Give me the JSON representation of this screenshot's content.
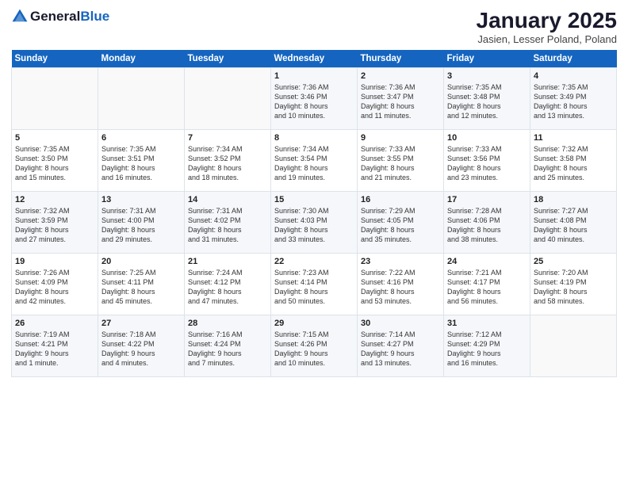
{
  "header": {
    "logo_general": "General",
    "logo_blue": "Blue",
    "title": "January 2025",
    "subtitle": "Jasien, Lesser Poland, Poland"
  },
  "days_of_week": [
    "Sunday",
    "Monday",
    "Tuesday",
    "Wednesday",
    "Thursday",
    "Friday",
    "Saturday"
  ],
  "weeks": [
    [
      {
        "day": "",
        "info": ""
      },
      {
        "day": "",
        "info": ""
      },
      {
        "day": "",
        "info": ""
      },
      {
        "day": "1",
        "info": "Sunrise: 7:36 AM\nSunset: 3:46 PM\nDaylight: 8 hours\nand 10 minutes."
      },
      {
        "day": "2",
        "info": "Sunrise: 7:36 AM\nSunset: 3:47 PM\nDaylight: 8 hours\nand 11 minutes."
      },
      {
        "day": "3",
        "info": "Sunrise: 7:35 AM\nSunset: 3:48 PM\nDaylight: 8 hours\nand 12 minutes."
      },
      {
        "day": "4",
        "info": "Sunrise: 7:35 AM\nSunset: 3:49 PM\nDaylight: 8 hours\nand 13 minutes."
      }
    ],
    [
      {
        "day": "5",
        "info": "Sunrise: 7:35 AM\nSunset: 3:50 PM\nDaylight: 8 hours\nand 15 minutes."
      },
      {
        "day": "6",
        "info": "Sunrise: 7:35 AM\nSunset: 3:51 PM\nDaylight: 8 hours\nand 16 minutes."
      },
      {
        "day": "7",
        "info": "Sunrise: 7:34 AM\nSunset: 3:52 PM\nDaylight: 8 hours\nand 18 minutes."
      },
      {
        "day": "8",
        "info": "Sunrise: 7:34 AM\nSunset: 3:54 PM\nDaylight: 8 hours\nand 19 minutes."
      },
      {
        "day": "9",
        "info": "Sunrise: 7:33 AM\nSunset: 3:55 PM\nDaylight: 8 hours\nand 21 minutes."
      },
      {
        "day": "10",
        "info": "Sunrise: 7:33 AM\nSunset: 3:56 PM\nDaylight: 8 hours\nand 23 minutes."
      },
      {
        "day": "11",
        "info": "Sunrise: 7:32 AM\nSunset: 3:58 PM\nDaylight: 8 hours\nand 25 minutes."
      }
    ],
    [
      {
        "day": "12",
        "info": "Sunrise: 7:32 AM\nSunset: 3:59 PM\nDaylight: 8 hours\nand 27 minutes."
      },
      {
        "day": "13",
        "info": "Sunrise: 7:31 AM\nSunset: 4:00 PM\nDaylight: 8 hours\nand 29 minutes."
      },
      {
        "day": "14",
        "info": "Sunrise: 7:31 AM\nSunset: 4:02 PM\nDaylight: 8 hours\nand 31 minutes."
      },
      {
        "day": "15",
        "info": "Sunrise: 7:30 AM\nSunset: 4:03 PM\nDaylight: 8 hours\nand 33 minutes."
      },
      {
        "day": "16",
        "info": "Sunrise: 7:29 AM\nSunset: 4:05 PM\nDaylight: 8 hours\nand 35 minutes."
      },
      {
        "day": "17",
        "info": "Sunrise: 7:28 AM\nSunset: 4:06 PM\nDaylight: 8 hours\nand 38 minutes."
      },
      {
        "day": "18",
        "info": "Sunrise: 7:27 AM\nSunset: 4:08 PM\nDaylight: 8 hours\nand 40 minutes."
      }
    ],
    [
      {
        "day": "19",
        "info": "Sunrise: 7:26 AM\nSunset: 4:09 PM\nDaylight: 8 hours\nand 42 minutes."
      },
      {
        "day": "20",
        "info": "Sunrise: 7:25 AM\nSunset: 4:11 PM\nDaylight: 8 hours\nand 45 minutes."
      },
      {
        "day": "21",
        "info": "Sunrise: 7:24 AM\nSunset: 4:12 PM\nDaylight: 8 hours\nand 47 minutes."
      },
      {
        "day": "22",
        "info": "Sunrise: 7:23 AM\nSunset: 4:14 PM\nDaylight: 8 hours\nand 50 minutes."
      },
      {
        "day": "23",
        "info": "Sunrise: 7:22 AM\nSunset: 4:16 PM\nDaylight: 8 hours\nand 53 minutes."
      },
      {
        "day": "24",
        "info": "Sunrise: 7:21 AM\nSunset: 4:17 PM\nDaylight: 8 hours\nand 56 minutes."
      },
      {
        "day": "25",
        "info": "Sunrise: 7:20 AM\nSunset: 4:19 PM\nDaylight: 8 hours\nand 58 minutes."
      }
    ],
    [
      {
        "day": "26",
        "info": "Sunrise: 7:19 AM\nSunset: 4:21 PM\nDaylight: 9 hours\nand 1 minute."
      },
      {
        "day": "27",
        "info": "Sunrise: 7:18 AM\nSunset: 4:22 PM\nDaylight: 9 hours\nand 4 minutes."
      },
      {
        "day": "28",
        "info": "Sunrise: 7:16 AM\nSunset: 4:24 PM\nDaylight: 9 hours\nand 7 minutes."
      },
      {
        "day": "29",
        "info": "Sunrise: 7:15 AM\nSunset: 4:26 PM\nDaylight: 9 hours\nand 10 minutes."
      },
      {
        "day": "30",
        "info": "Sunrise: 7:14 AM\nSunset: 4:27 PM\nDaylight: 9 hours\nand 13 minutes."
      },
      {
        "day": "31",
        "info": "Sunrise: 7:12 AM\nSunset: 4:29 PM\nDaylight: 9 hours\nand 16 minutes."
      },
      {
        "day": "",
        "info": ""
      }
    ]
  ]
}
